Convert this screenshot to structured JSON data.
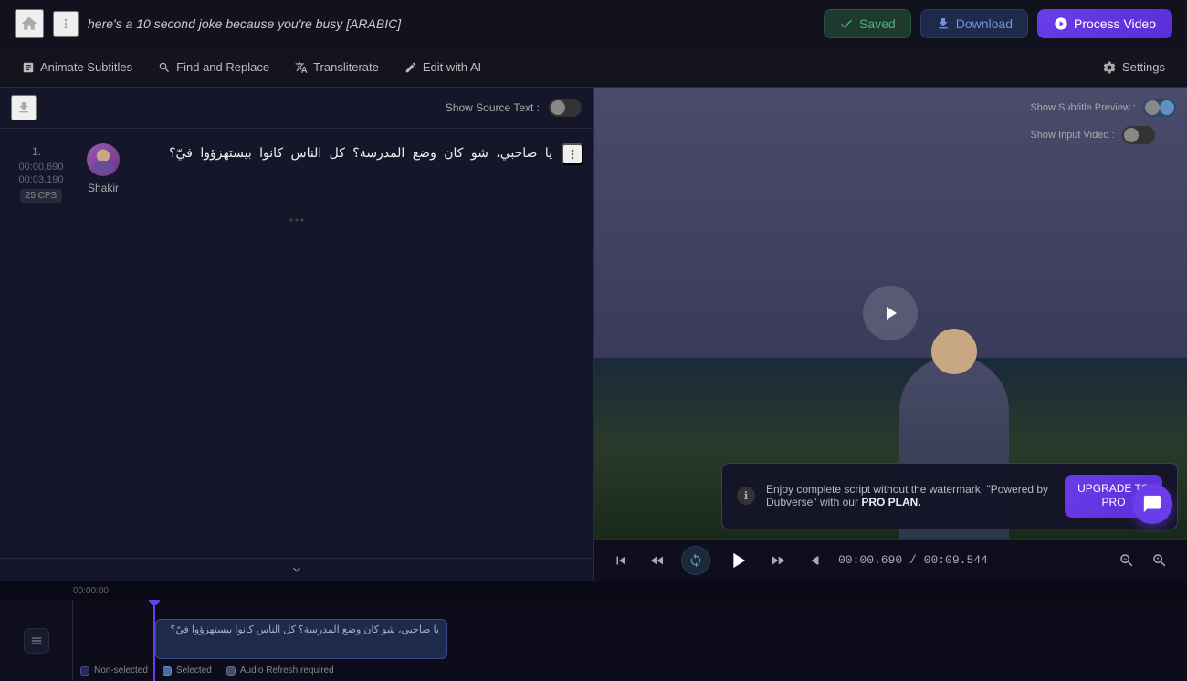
{
  "header": {
    "title": "here's a 10 second joke because you're busy  [ARABIC]",
    "saved_label": "Saved",
    "download_label": "Download",
    "process_label": "Process Video"
  },
  "toolbar": {
    "animate_label": "Animate Subtitles",
    "find_replace_label": "Find and Replace",
    "transliterate_label": "Transliterate",
    "edit_ai_label": "Edit with AI",
    "settings_label": "Settings"
  },
  "subtitle_panel": {
    "show_source_label": "Show Source Text :",
    "subtitle_items": [
      {
        "number": "1.",
        "time_start": "00:00.690",
        "time_end": "00:03.190",
        "text": "يا صاحبي، شو كان وضع المدرسة؟ كل الناس كانوا بيستهزؤوا فيّ؟",
        "speaker": "Shakir",
        "badge": "25 CPS"
      }
    ]
  },
  "video_panel": {
    "show_subtitle_preview_label": "Show Subtitle Preview :",
    "show_input_video_label": "Show Input Video :",
    "upgrade_text": "Enjoy complete script without the watermark, \"Powered by Dubverse\" with our",
    "upgrade_pro_text": "PRO PLAN.",
    "upgrade_button_line1": "UPGRADE TO",
    "upgrade_button_line2": "PRO"
  },
  "player": {
    "current_time": "00:00.690",
    "total_time": "00:09.544"
  },
  "timeline": {
    "time_label": "00:00:00",
    "subtitle_text": "يا صاحبي، شو كان وضع المدرسة؟ كل الناس كانوا بيستهزؤوا فيّ؟",
    "legend": {
      "non_selected": "Non-selected",
      "selected": "Selected",
      "audio_refresh": "Audio Refresh required"
    }
  }
}
